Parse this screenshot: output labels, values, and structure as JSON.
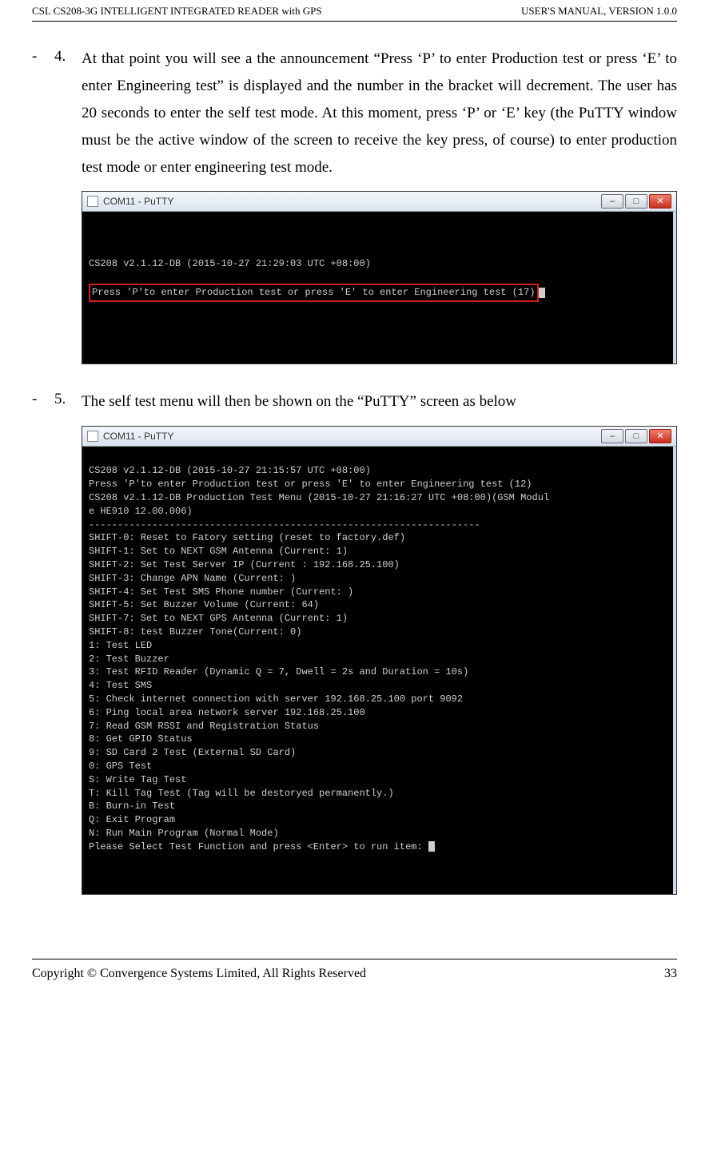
{
  "header": {
    "left": "CSL CS208-3G INTELLIGENT INTEGRATED READER with GPS",
    "right": "USER'S  MANUAL,  VERSION  1.0.0"
  },
  "item4": {
    "dash": "-",
    "num": "4.",
    "text": "At that point you will see a the announcement “Press ‘P’ to enter Production test or press ‘E’ to enter Engineering test” is displayed and the number in the bracket will decrement.   The user has 20 seconds to enter the self test mode. At this moment, press ‘P’ or ‘E’ key (the PuTTY window must be the active window of the screen to receive the key press, of course) to enter production test mode or enter engineering test mode."
  },
  "item5": {
    "dash": "-",
    "num": "5.",
    "text": "The self test menu will then be shown on the “PuTTY” screen as below"
  },
  "putty": {
    "title": "COM11 - PuTTY",
    "minimize": "–",
    "maximize": "□",
    "close": "✕"
  },
  "term1": {
    "l1": "CS208 v2.1.12-DB (2015-10-27 21:29:03 UTC +08:00)",
    "l2": "Press 'P'to enter Production test or press 'E' to enter Engineering test (17)"
  },
  "term2": {
    "lines": [
      "CS208 v2.1.12-DB (2015-10-27 21:15:57 UTC +08:00)",
      "Press 'P'to enter Production test or press 'E' to enter Engineering test (12)",
      "CS208 v2.1.12-DB Production Test Menu (2015-10-27 21:16:27 UTC +08:00)(GSM Modul",
      "e HE910 12.00.006)",
      "--------------------------------------------------------------------",
      "SHIFT-0: Reset to Fatory setting (reset to factory.def)",
      "SHIFT-1: Set to NEXT GSM Antenna (Current: 1)",
      "SHIFT-2: Set Test Server IP (Current : 192.168.25.100)",
      "SHIFT-3: Change APN Name (Current: )",
      "SHIFT-4: Set Test SMS Phone number (Current: )",
      "SHIFT-5: Set Buzzer Volume (Current: 64)",
      "SHIFT-7: Set to NEXT GPS Antenna (Current: 1)",
      "SHIFT-8: test Buzzer Tone(Current: 0)",
      "",
      "1: Test LED",
      "2: Test Buzzer",
      "3: Test RFID Reader (Dynamic Q = 7, Dwell = 2s and Duration = 10s)",
      "4: Test SMS",
      "5: Check internet connection with server 192.168.25.100 port 9092",
      "6: Ping local area network server 192.168.25.100",
      "7: Read GSM RSSI and Registration Status",
      "8: Get GPIO Status",
      "9: SD Card 2 Test (External SD Card)",
      "0: GPS Test",
      "S: Write Tag Test",
      "T: Kill Tag Test (Tag will be destoryed permanently.)",
      "",
      "B: Burn-in Test",
      "Q: Exit Program",
      "N: Run Main Program (Normal Mode)",
      "Please Select Test Function and press <Enter> to run item: "
    ]
  },
  "footer": {
    "left": "Copyright © Convergence Systems Limited, All Rights Reserved",
    "right": "33"
  }
}
